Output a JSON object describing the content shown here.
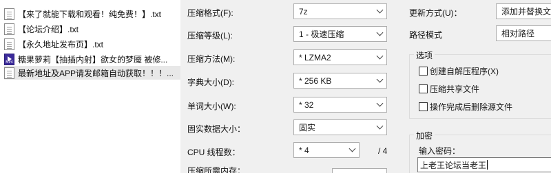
{
  "files": [
    {
      "name": "【来了就能下载和观看！纯免费！】.txt",
      "icon": "text-file-icon",
      "selected": false
    },
    {
      "name": "【论坛介绍】.txt",
      "icon": "text-file-icon",
      "selected": false
    },
    {
      "name": "【永久地址发布页】.txt",
      "icon": "text-file-icon",
      "selected": false
    },
    {
      "name": "糖果萝莉【抽插内射】欲女的梦魇 被修...",
      "icon": "mp4-file-icon",
      "selected": false
    },
    {
      "name": "最新地址及APP请发邮箱自动获取！！！...",
      "icon": "text-file-icon",
      "selected": true
    }
  ],
  "archive_options": {
    "format_label": "压缩格式(F):",
    "format_value": "7z",
    "level_label": "压缩等级(L):",
    "level_value": "1 - 极速压缩",
    "method_label": "压缩方法(M):",
    "method_value": "* LZMA2",
    "dict_label": "字典大小(D):",
    "dict_value": "* 256 KB",
    "word_label": "单词大小(W):",
    "word_value": "* 32",
    "solid_label": "固实数据大小：",
    "solid_value": "固实",
    "threads_label": "CPU 线程数：",
    "threads_value": "* 4",
    "threads_total": "/ 4",
    "memory_label": "压缩所需内存："
  },
  "update": {
    "mode_label": "更新方式(U)：",
    "mode_value": "添加并替换文件",
    "path_label": "路径模式",
    "path_value": "相对路径"
  },
  "options_group": {
    "title": "选项",
    "sfx": "创建自解压程序(X)",
    "shared": "压缩共享文件",
    "delete": "操作完成后删除源文件"
  },
  "encryption": {
    "title": "加密",
    "password_label": "输入密码：",
    "password_value": "上老王论坛当老王"
  }
}
